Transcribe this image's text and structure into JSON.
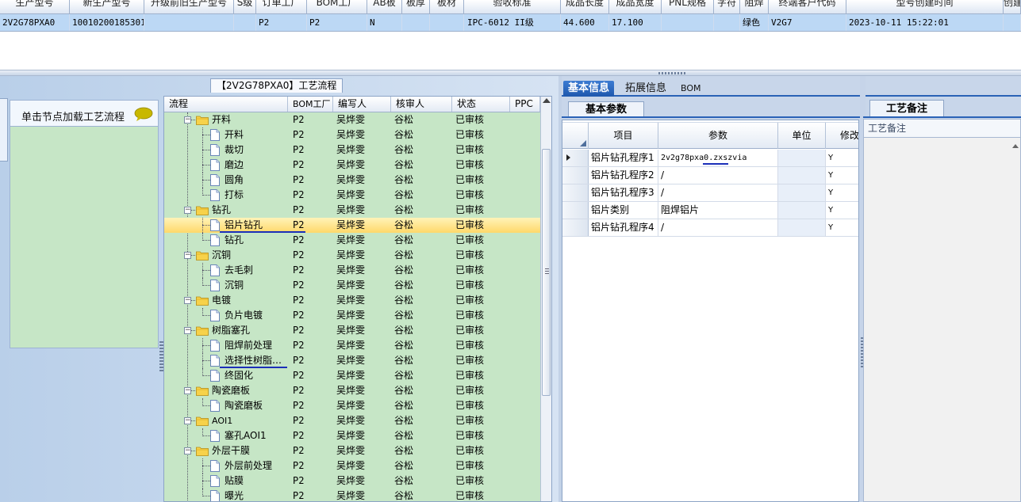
{
  "top_grid": {
    "headers": [
      "生产型号",
      "新生产型号",
      "升级前旧生产型号",
      "S级",
      "订单工厂",
      "BOM工厂",
      "AB板",
      "板厚",
      "板材",
      "验收标准",
      "成品长度",
      "成品宽度",
      "PNL规格",
      "字符",
      "阻焊",
      "终端客户代码",
      "型号创建时间",
      "创建"
    ],
    "row": [
      "2V2G78PXA0",
      "10010200185301",
      "",
      "",
      "P2",
      "P2",
      "N",
      "",
      "",
      "IPC-6012 II级",
      "44.600",
      "17.100",
      "",
      "",
      "绿色",
      "V2G7",
      "2023-10-11 15:22:01",
      ""
    ]
  },
  "left_panel": {
    "node_tip": "单击节点加载工艺流程",
    "tree_title": "【2V2G78PXA0】工艺流程",
    "tree_headers": [
      "流程",
      "BOM工厂",
      "编写人",
      "核审人",
      "状态",
      "PPC"
    ],
    "tree_rows": [
      {
        "level": 0,
        "name": "开料",
        "bom": "P2",
        "writer": "吴烨雯",
        "reviewer": "谷松",
        "status": "已审核"
      },
      {
        "level": 1,
        "name": "开料",
        "bom": "P2",
        "writer": "吴烨雯",
        "reviewer": "谷松",
        "status": "已审核"
      },
      {
        "level": 1,
        "name": "裁切",
        "bom": "P2",
        "writer": "吴烨雯",
        "reviewer": "谷松",
        "status": "已审核"
      },
      {
        "level": 1,
        "name": "磨边",
        "bom": "P2",
        "writer": "吴烨雯",
        "reviewer": "谷松",
        "status": "已审核"
      },
      {
        "level": 1,
        "name": "圆角",
        "bom": "P2",
        "writer": "吴烨雯",
        "reviewer": "谷松",
        "status": "已审核"
      },
      {
        "level": 1,
        "name": "打标",
        "bom": "P2",
        "writer": "吴烨雯",
        "reviewer": "谷松",
        "status": "已审核"
      },
      {
        "level": 0,
        "name": "钻孔",
        "bom": "P2",
        "writer": "吴烨雯",
        "reviewer": "谷松",
        "status": "已审核"
      },
      {
        "level": 1,
        "name": "铝片钻孔",
        "bom": "P2",
        "writer": "吴烨雯",
        "reviewer": "谷松",
        "status": "已审核",
        "selected": true
      },
      {
        "level": 1,
        "name": "钻孔",
        "bom": "P2",
        "writer": "吴烨雯",
        "reviewer": "谷松",
        "status": "已审核"
      },
      {
        "level": 0,
        "name": "沉铜",
        "bom": "P2",
        "writer": "吴烨雯",
        "reviewer": "谷松",
        "status": "已审核"
      },
      {
        "level": 1,
        "name": "去毛刺",
        "bom": "P2",
        "writer": "吴烨雯",
        "reviewer": "谷松",
        "status": "已审核"
      },
      {
        "level": 1,
        "name": "沉铜",
        "bom": "P2",
        "writer": "吴烨雯",
        "reviewer": "谷松",
        "status": "已审核"
      },
      {
        "level": 0,
        "name": "电镀",
        "bom": "P2",
        "writer": "吴烨雯",
        "reviewer": "谷松",
        "status": "已审核"
      },
      {
        "level": 1,
        "name": "负片电镀",
        "bom": "P2",
        "writer": "吴烨雯",
        "reviewer": "谷松",
        "status": "已审核"
      },
      {
        "level": 0,
        "name": "树脂塞孔",
        "bom": "P2",
        "writer": "吴烨雯",
        "reviewer": "谷松",
        "status": "已审核"
      },
      {
        "level": 1,
        "name": "阻焊前处理",
        "bom": "P2",
        "writer": "吴烨雯",
        "reviewer": "谷松",
        "status": "已审核"
      },
      {
        "level": 1,
        "name": "选择性树脂…",
        "bom": "P2",
        "writer": "吴烨雯",
        "reviewer": "谷松",
        "status": "已审核"
      },
      {
        "level": 1,
        "name": "终固化",
        "bom": "P2",
        "writer": "吴烨雯",
        "reviewer": "谷松",
        "status": "已审核"
      },
      {
        "level": 0,
        "name": "陶瓷磨板",
        "bom": "P2",
        "writer": "吴烨雯",
        "reviewer": "谷松",
        "status": "已审核"
      },
      {
        "level": 1,
        "name": "陶瓷磨板",
        "bom": "P2",
        "writer": "吴烨雯",
        "reviewer": "谷松",
        "status": "已审核"
      },
      {
        "level": 0,
        "name": "AOI1",
        "bom": "P2",
        "writer": "吴烨雯",
        "reviewer": "谷松",
        "status": "已审核"
      },
      {
        "level": 1,
        "name": "塞孔AOI1",
        "bom": "P2",
        "writer": "吴烨雯",
        "reviewer": "谷松",
        "status": "已审核"
      },
      {
        "level": 0,
        "name": "外层干膜",
        "bom": "P2",
        "writer": "吴烨雯",
        "reviewer": "谷松",
        "status": "已审核"
      },
      {
        "level": 1,
        "name": "外层前处理",
        "bom": "P2",
        "writer": "吴烨雯",
        "reviewer": "谷松",
        "status": "已审核"
      },
      {
        "level": 1,
        "name": "贴膜",
        "bom": "P2",
        "writer": "吴烨雯",
        "reviewer": "谷松",
        "status": "已审核"
      },
      {
        "level": 1,
        "name": "曝光",
        "bom": "P2",
        "writer": "吴烨雯",
        "reviewer": "谷松",
        "status": "已审核"
      }
    ]
  },
  "info_panel": {
    "tabs": [
      "基本信息",
      "拓展信息",
      "BOM"
    ],
    "active_tab": "基本信息",
    "subtab": "基本参数",
    "param_headers": [
      "项目",
      "参数",
      "单位",
      "修改"
    ],
    "params": [
      {
        "item": "铝片钻孔程序1",
        "value": "2v2g78pxa0.zxszvia",
        "unit": "",
        "modified": "Y"
      },
      {
        "item": "铝片钻孔程序2",
        "value": "/",
        "unit": "",
        "modified": "Y"
      },
      {
        "item": "铝片钻孔程序3",
        "value": "/",
        "unit": "",
        "modified": "Y"
      },
      {
        "item": "铝片类别",
        "value": "阻焊铝片",
        "unit": "",
        "modified": "Y"
      },
      {
        "item": "铝片钻孔程序4",
        "value": "/",
        "unit": "",
        "modified": "Y"
      }
    ],
    "note_tab": "工艺备注",
    "note_header": "工艺备注"
  },
  "colors": {
    "selection_row": "#bcd8f5",
    "tree_bg": "#c6e6c6",
    "tree_selected": "#ffd86a",
    "tab_active": "#2a62b6",
    "annotation_underline": "#1b2fb8"
  }
}
